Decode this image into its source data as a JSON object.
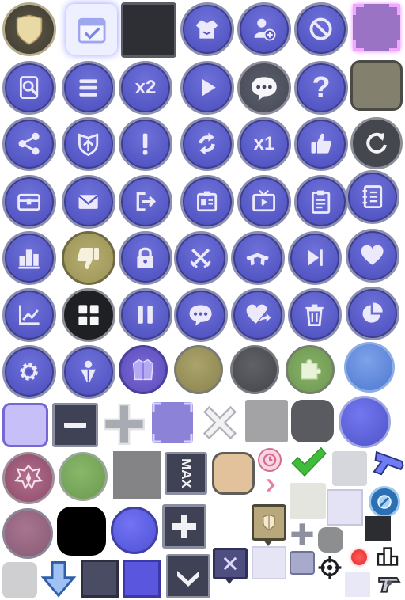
{
  "atlas": {
    "x2_label": "x2",
    "x1_label": "x1",
    "max_label": "MAX",
    "question_label": "?"
  },
  "colors": {
    "button_fill": "#5457c4",
    "button_ring": "#8c8fb0",
    "glyph_light": "#f1eefc",
    "olive": "#b5ad6e",
    "slate": "#5a5e6a",
    "lilac": "#c6bff5",
    "green_check": "#3fbd3a"
  }
}
